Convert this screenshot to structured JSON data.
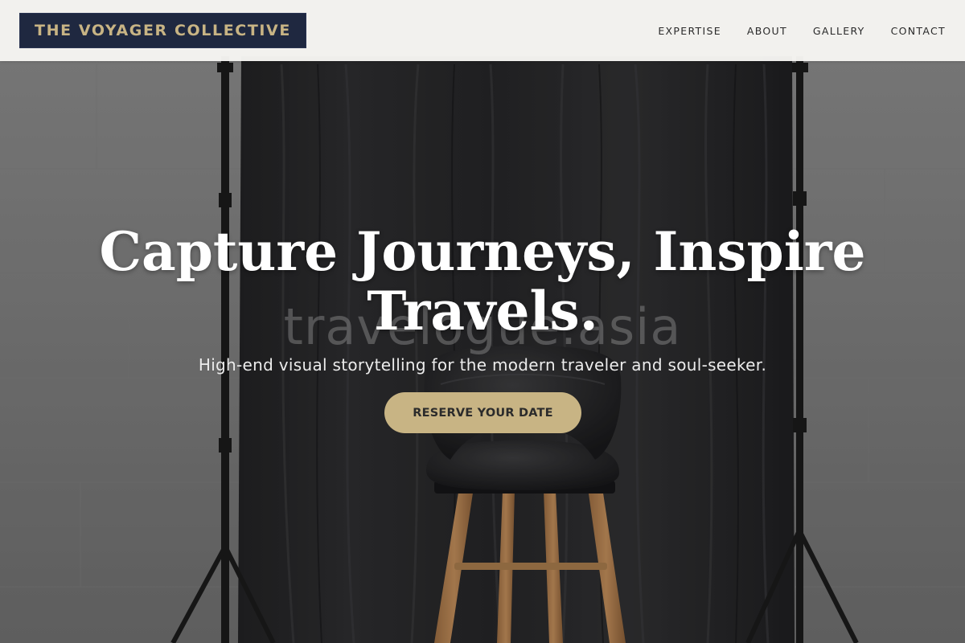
{
  "brand": {
    "name": "THE VOYAGER COLLECTIVE",
    "colors": {
      "navy": "#1f2840",
      "gold": "#c8b484"
    }
  },
  "nav": {
    "items": [
      {
        "label": "EXPERTISE"
      },
      {
        "label": "ABOUT"
      },
      {
        "label": "GALLERY"
      },
      {
        "label": "CONTACT"
      }
    ]
  },
  "hero": {
    "title_line1": "Capture Journeys, Inspire",
    "title_line2": "Travels.",
    "subtitle": "High-end visual storytelling for the modern traveler and soul-seeker.",
    "cta_label": "RESERVE YOUR DATE",
    "watermark": "travelogue.asia",
    "background_image": "studio backdrop with black stool"
  }
}
